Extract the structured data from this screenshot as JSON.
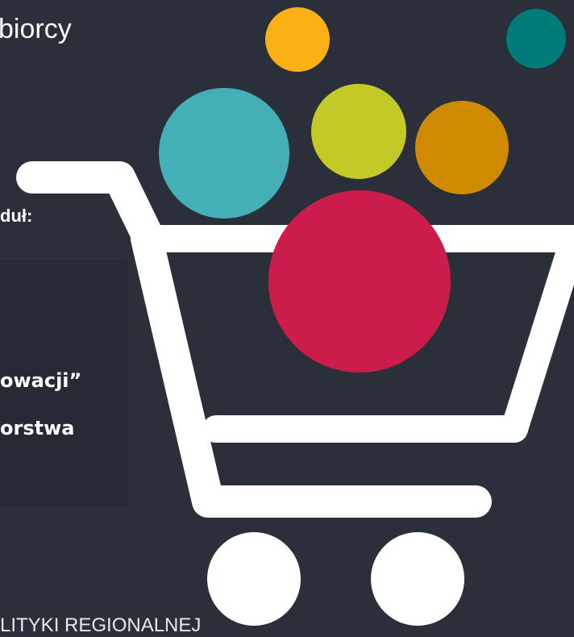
{
  "heading": {
    "text": "biorcy"
  },
  "module": {
    "label": "duł:"
  },
  "panel": {
    "line1": "owacji”",
    "line2": "orstwa"
  },
  "footer": {
    "text": "LITYKI REGIONALNEJ"
  },
  "colors": {
    "background": "#2a2f39",
    "panel": "#252a34",
    "cart": "#ffffff",
    "orange": "#fbb016",
    "teal_dark": "#007b7a",
    "teal": "#45afb8",
    "lime": "#c3c927",
    "amber": "#cf8a02",
    "crimson": "#cc1c4b"
  },
  "icons": {
    "cart": "shopping-cart-icon",
    "balls": "colored-balls-decoration"
  }
}
